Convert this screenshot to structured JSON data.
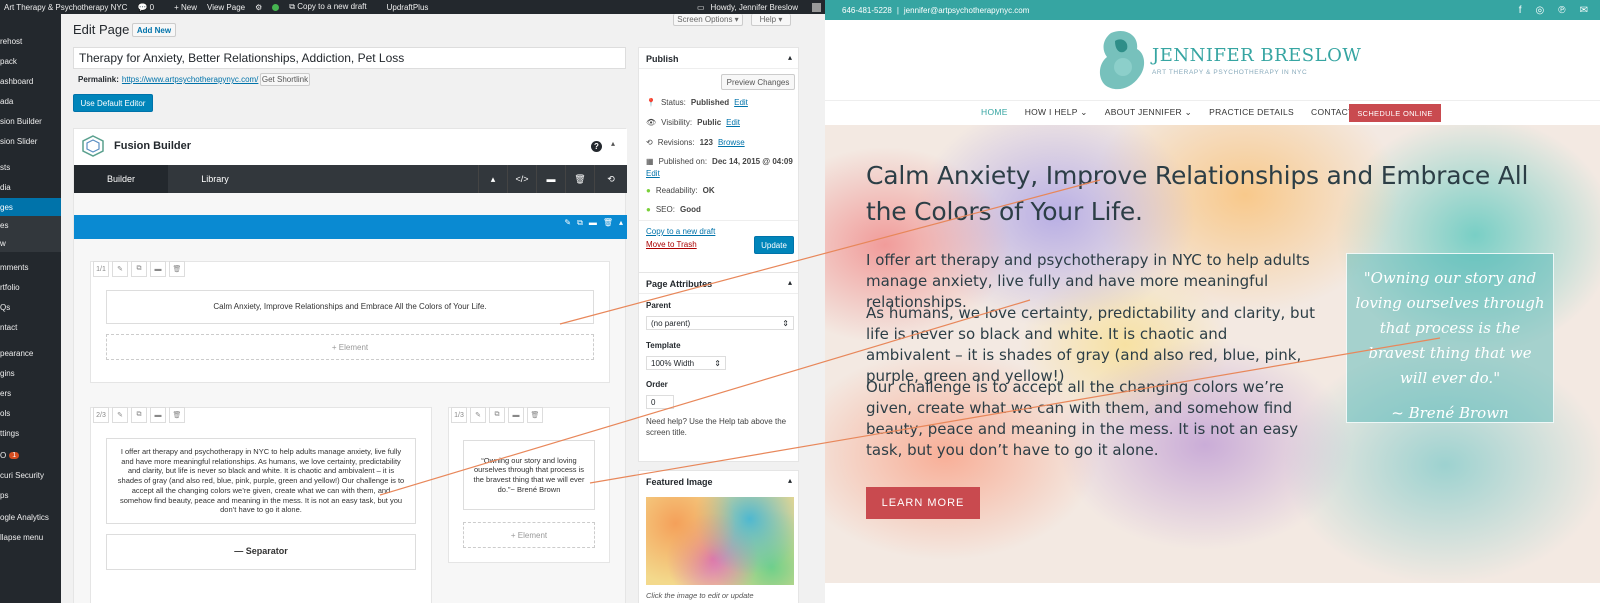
{
  "adminbar": {
    "site_name": "Art Therapy & Psychotherapy NYC",
    "comments_count": "0",
    "new_label": "+ New",
    "view_page": "View Page",
    "copy_draft": "Copy to a new draft",
    "updraft": "UpdraftPlus",
    "howdy": "Howdy, Jennifer Breslow"
  },
  "sidebar": {
    "items": [
      "rehost",
      "pack",
      "ashboard",
      "ada",
      "sion Builder",
      "sion Slider",
      "sts",
      "dia",
      "ges",
      "es",
      "w",
      "mments",
      "rtfolio",
      "Qs",
      "ntact",
      "pearance",
      "gins",
      "ers",
      "ols",
      "ttings",
      "O",
      "curi Security",
      "ps",
      "ogle Analytics",
      "llapse menu"
    ],
    "seo_badge": "1"
  },
  "editor": {
    "heading": "Edit Page",
    "add_new": "Add New",
    "screen_options": "Screen Options",
    "help": "Help",
    "title_value": "Therapy for Anxiety, Better Relationships, Addiction, Pet Loss",
    "permalink_label": "Permalink:",
    "permalink_url": "https://www.artpsychotherapynyc.com/",
    "get_shortlink": "Get Shortlink",
    "default_editor_btn": "Use Default Editor"
  },
  "fusion": {
    "title": "Fusion Builder",
    "tab_builder": "Builder",
    "tab_library": "Library",
    "row1_fraction": "1/1",
    "row1_text": "Calm Anxiety, Improve Relationships and Embrace All the Colors of Your Life.",
    "add_element": "+ Element",
    "col_left_fraction": "2/3",
    "col_left_text": "I offer art therapy and psychotherapy in NYC to help adults manage anxiety, live fully and have more meaningful relationships. As humans, we love certainty, predictability and clarity, but life is never so black and white. It is chaotic and ambivalent – it is shades of gray (and also red, blue, pink, purple, green and yellow!) Our challenge is to accept all the changing colors we’re given, create what we can with them, and somehow find beauty, peace and meaning in the mess. It is not an easy task, but you don’t have to go it alone.",
    "separator": "— Separator",
    "col_right_fraction": "1/3",
    "col_right_text": "“Owning our story and loving ourselves through that process is the bravest thing that we will ever do.”~ Brené Brown",
    "add_element_right": "+ Element"
  },
  "publish": {
    "title": "Publish",
    "preview": "Preview Changes",
    "status_label": "Status:",
    "status_value": "Published",
    "edit": "Edit",
    "visibility_label": "Visibility:",
    "visibility_value": "Public",
    "revisions_label": "Revisions:",
    "revisions_value": "123",
    "browse": "Browse",
    "published_on_label": "Published on:",
    "published_on_value": "Dec 14, 2015 @ 04:09",
    "readability_label": "Readability:",
    "readability_value": "OK",
    "seo_label": "SEO:",
    "seo_value": "Good",
    "copy_draft": "Copy to a new draft",
    "trash": "Move to Trash",
    "update": "Update"
  },
  "attributes": {
    "title": "Page Attributes",
    "parent_label": "Parent",
    "parent_value": "(no parent)",
    "template_label": "Template",
    "template_value": "100% Width",
    "order_label": "Order",
    "order_value": "0",
    "help_text": "Need help? Use the Help tab above the screen title."
  },
  "featured": {
    "title": "Featured Image",
    "caption": "Click the image to edit or update"
  },
  "site": {
    "phone": "646-481-5228",
    "separator": "|",
    "email": "jennifer@artpsychotherapynyc.com",
    "logo_name": "JENNIFER BRESLOW",
    "logo_tagline": "ART THERAPY & PSYCHOTHERAPY IN NYC",
    "nav": [
      "HOME",
      "HOW I HELP",
      "ABOUT JENNIFER",
      "PRACTICE DETAILS",
      "CONTACT"
    ],
    "schedule": "SCHEDULE ONLINE",
    "hero_title": "Calm Anxiety, Improve Relationships and Embrace All the Colors of Your Life.",
    "hero_p1": "I offer art therapy and psychotherapy in NYC to help adults manage anxiety, live fully and have more meaningful relationships.",
    "hero_p2": "As humans, we love certainty, predictability and clarity, but life is never so black and white. It is chaotic and ambivalent – it is shades of gray (and also red, blue, pink, purple, green and yellow!)",
    "hero_p3": "Our challenge is to accept all the changing colors we’re given, create what we can with them, and somehow find beauty, peace and meaning in the mess. It is not an easy task, but you don’t have to go it alone.",
    "quote": "\"Owning our story and loving ourselves through that process is the bravest thing that we will ever do.\"",
    "quote_author": "~ Brené Brown",
    "learn_more": "LEARN MORE"
  },
  "colors": {
    "wp_dark": "#23282d",
    "wp_blue": "#0073aa",
    "fusion_bar": "#0a8ad2",
    "teal": "#36a5a2",
    "accent_red": "#c94a4f",
    "arrow": "#e8875a"
  }
}
